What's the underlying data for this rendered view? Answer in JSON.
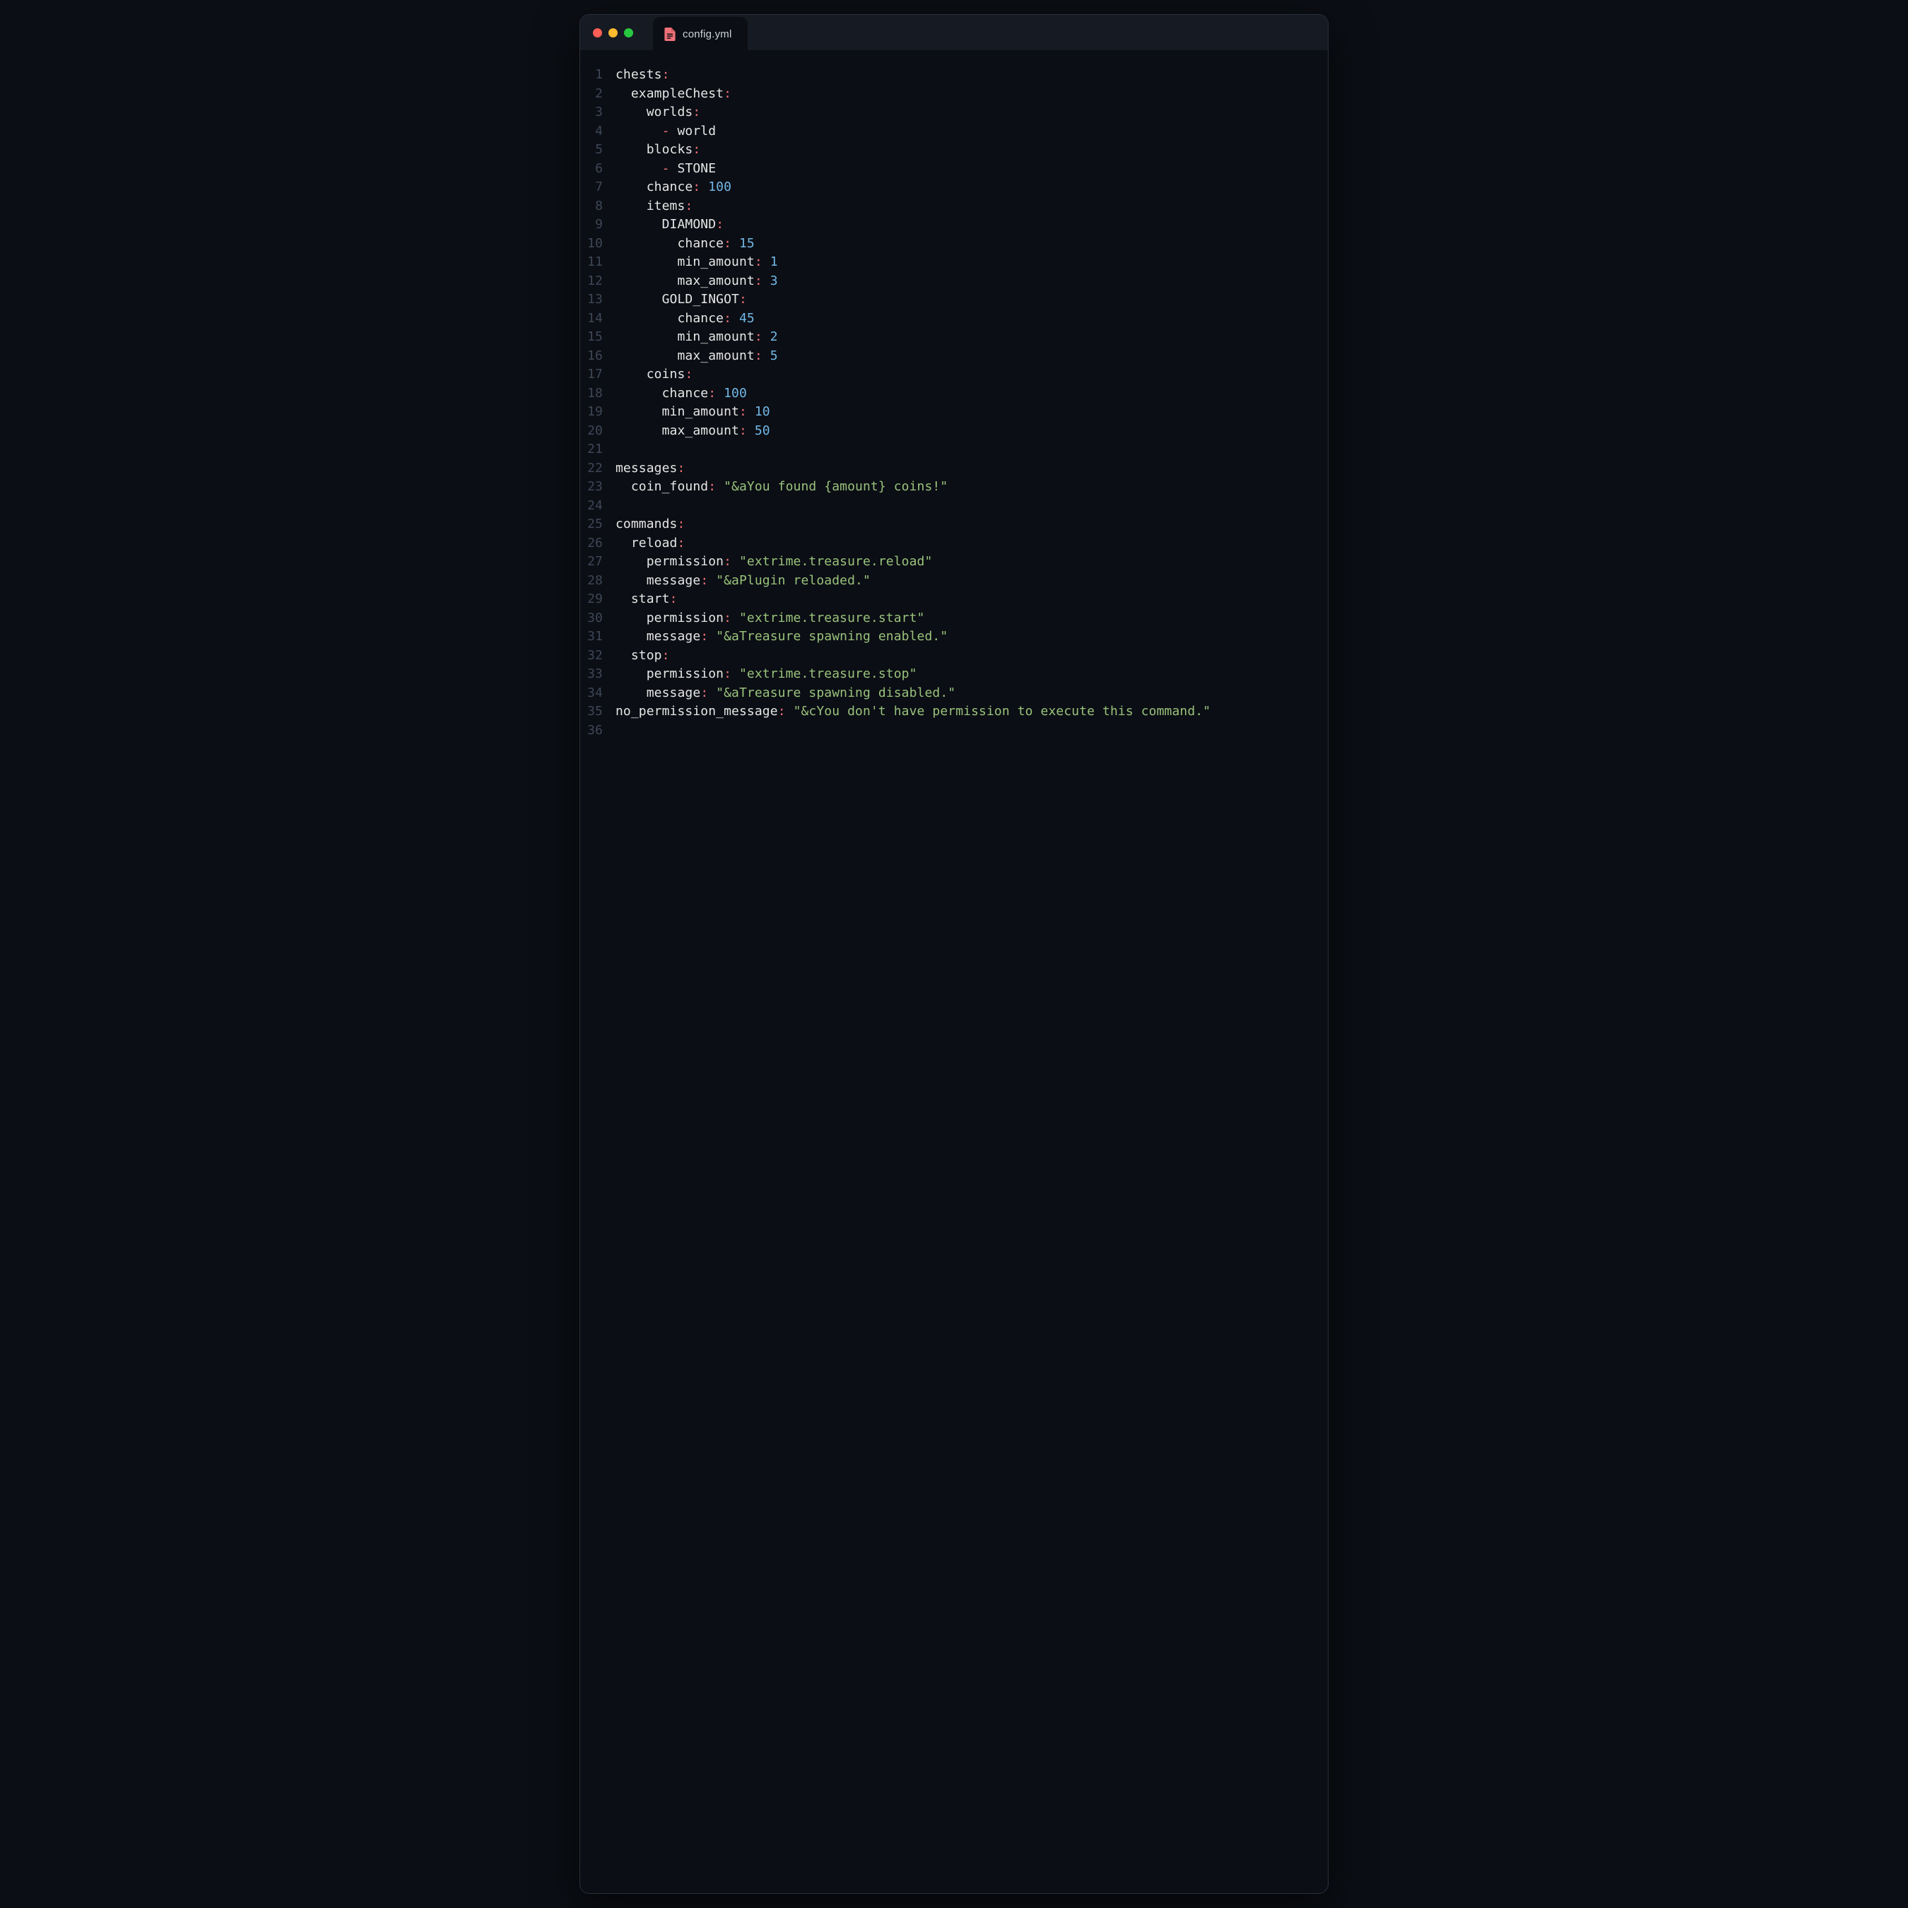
{
  "tab": {
    "filename": "config.yml"
  },
  "gutter": {
    "count": 36
  },
  "colors": {
    "icon_accent": "#f07178"
  },
  "code": {
    "l1": {
      "k": "chests"
    },
    "l2": {
      "k": "exampleChest"
    },
    "l3": {
      "k": "worlds"
    },
    "l4": {
      "dash": "-",
      "v": "world"
    },
    "l5": {
      "k": "blocks"
    },
    "l6": {
      "dash": "-",
      "v": "STONE"
    },
    "l7": {
      "k": "chance",
      "v": "100"
    },
    "l8": {
      "k": "items"
    },
    "l9": {
      "k": "DIAMOND"
    },
    "l10": {
      "k": "chance",
      "v": "15"
    },
    "l11": {
      "k": "min_amount",
      "v": "1"
    },
    "l12": {
      "k": "max_amount",
      "v": "3"
    },
    "l13": {
      "k": "GOLD_INGOT"
    },
    "l14": {
      "k": "chance",
      "v": "45"
    },
    "l15": {
      "k": "min_amount",
      "v": "2"
    },
    "l16": {
      "k": "max_amount",
      "v": "5"
    },
    "l17": {
      "k": "coins"
    },
    "l18": {
      "k": "chance",
      "v": "100"
    },
    "l19": {
      "k": "min_amount",
      "v": "10"
    },
    "l20": {
      "k": "max_amount",
      "v": "50"
    },
    "l22": {
      "k": "messages"
    },
    "l23": {
      "k": "coin_found",
      "v": "\"&aYou found {amount} coins!\""
    },
    "l25": {
      "k": "commands"
    },
    "l26": {
      "k": "reload"
    },
    "l27": {
      "k": "permission",
      "v": "\"extrime.treasure.reload\""
    },
    "l28": {
      "k": "message",
      "v": "\"&aPlugin reloaded.\""
    },
    "l29": {
      "k": "start"
    },
    "l30": {
      "k": "permission",
      "v": "\"extrime.treasure.start\""
    },
    "l31": {
      "k": "message",
      "v": "\"&aTreasure spawning enabled.\""
    },
    "l32": {
      "k": "stop"
    },
    "l33": {
      "k": "permission",
      "v": "\"extrime.treasure.stop\""
    },
    "l34": {
      "k": "message",
      "v": "\"&aTreasure spawning disabled.\""
    },
    "l35": {
      "k": "no_permission_message",
      "v": "\"&cYou don't have permission to execute this command.\""
    }
  }
}
